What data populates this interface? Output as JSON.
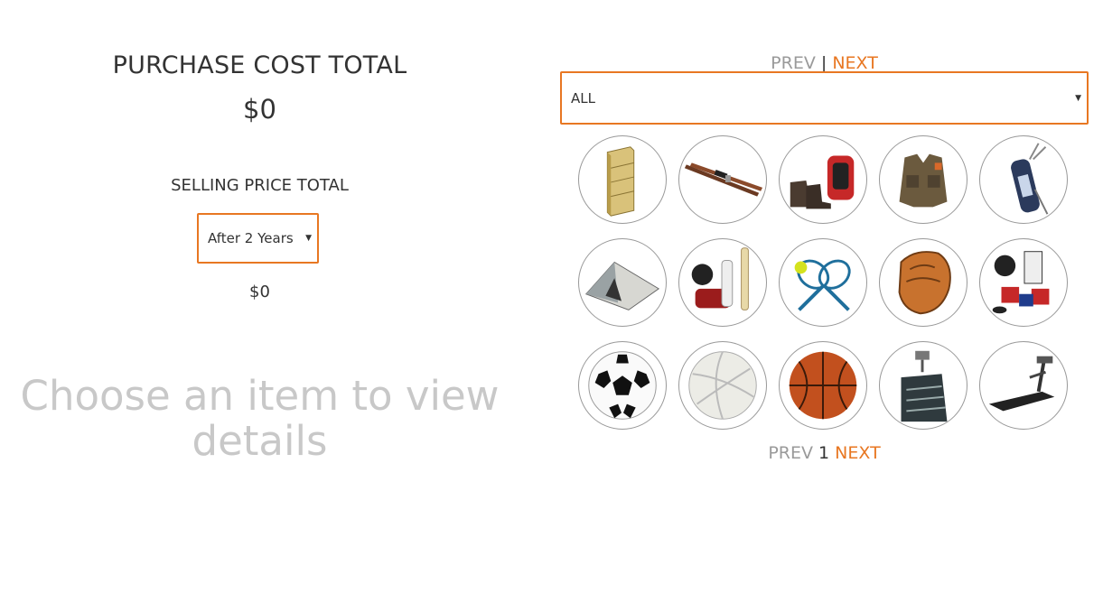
{
  "summary": {
    "purchase_title": "PURCHASE COST TOTAL",
    "purchase_value": "$0",
    "selling_title": "SELLING PRICE TOTAL",
    "period_selected": "After 2 Years",
    "selling_value": "$0",
    "placeholder": "Choose an item to view details"
  },
  "pager_top": {
    "prev": "PREV",
    "separator": "|",
    "next": "NEXT"
  },
  "category": {
    "selected": "ALL"
  },
  "items": [
    {
      "icon": "bookshelf-icon"
    },
    {
      "icon": "skis-icon"
    },
    {
      "icon": "hiking-boots-backpack-icon"
    },
    {
      "icon": "fishing-vest-icon"
    },
    {
      "icon": "golf-bag-icon"
    },
    {
      "icon": "tent-icon"
    },
    {
      "icon": "cricket-gear-icon"
    },
    {
      "icon": "tennis-rackets-icon"
    },
    {
      "icon": "baseball-glove-icon"
    },
    {
      "icon": "hockey-gear-icon"
    },
    {
      "icon": "soccer-ball-icon"
    },
    {
      "icon": "volleyball-icon"
    },
    {
      "icon": "basketball-icon"
    },
    {
      "icon": "stair-climber-icon"
    },
    {
      "icon": "treadmill-icon"
    }
  ],
  "pager_bottom": {
    "prev": "PREV",
    "page": "1",
    "next": "NEXT"
  },
  "colors": {
    "accent": "#e87722",
    "muted": "#9a9a9a",
    "placeholder": "#c8c8c8"
  }
}
